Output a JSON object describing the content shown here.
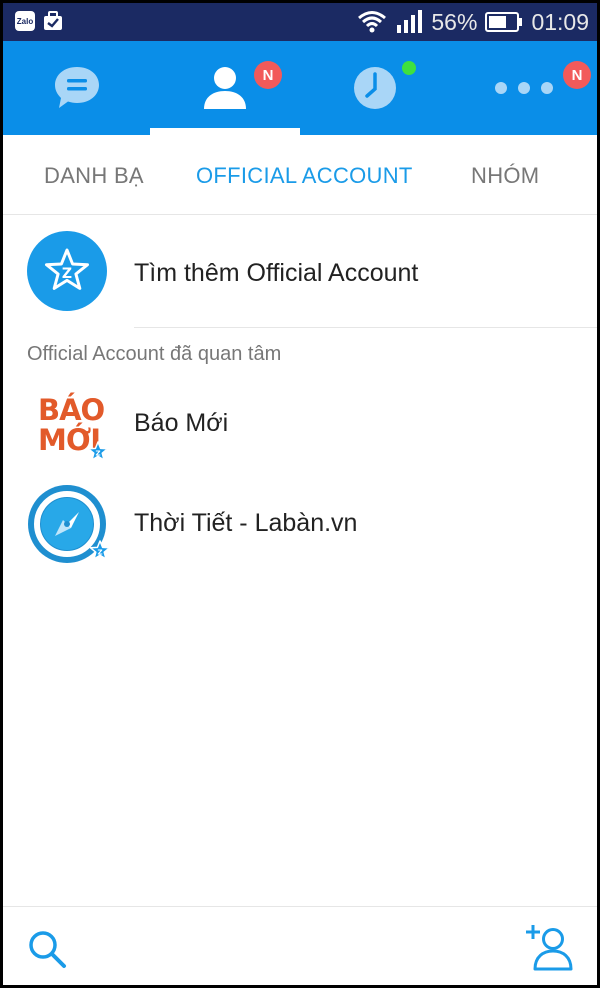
{
  "status_bar": {
    "notif_app_label": "Zalo",
    "battery_percent": "56%",
    "time": "01:09"
  },
  "top_tabs": {
    "active_index": 1,
    "contacts_badge": "N",
    "more_badge": "N"
  },
  "sub_tabs": [
    {
      "label": "DANH BẠ",
      "active": false
    },
    {
      "label": "OFFICIAL ACCOUNT",
      "active": true
    },
    {
      "label": "NHÓM",
      "active": false
    }
  ],
  "find_more": {
    "label": "Tìm thêm Official Account"
  },
  "section_header": "Official Account đã quan tâm",
  "accounts": [
    {
      "name": "Báo Mới",
      "logo_line1": "BÁO",
      "logo_line2": "MỚI"
    },
    {
      "name": "Thời Tiết - Labàn.vn"
    }
  ],
  "colors": {
    "status_bar": "#1b2a63",
    "top_bar": "#0a8ee8",
    "accent": "#1a9be8",
    "badge": "#f25a5a",
    "online_dot": "#3fe03f"
  },
  "icons": {
    "bottom_left": "search-icon",
    "bottom_right": "add-contact-icon"
  }
}
